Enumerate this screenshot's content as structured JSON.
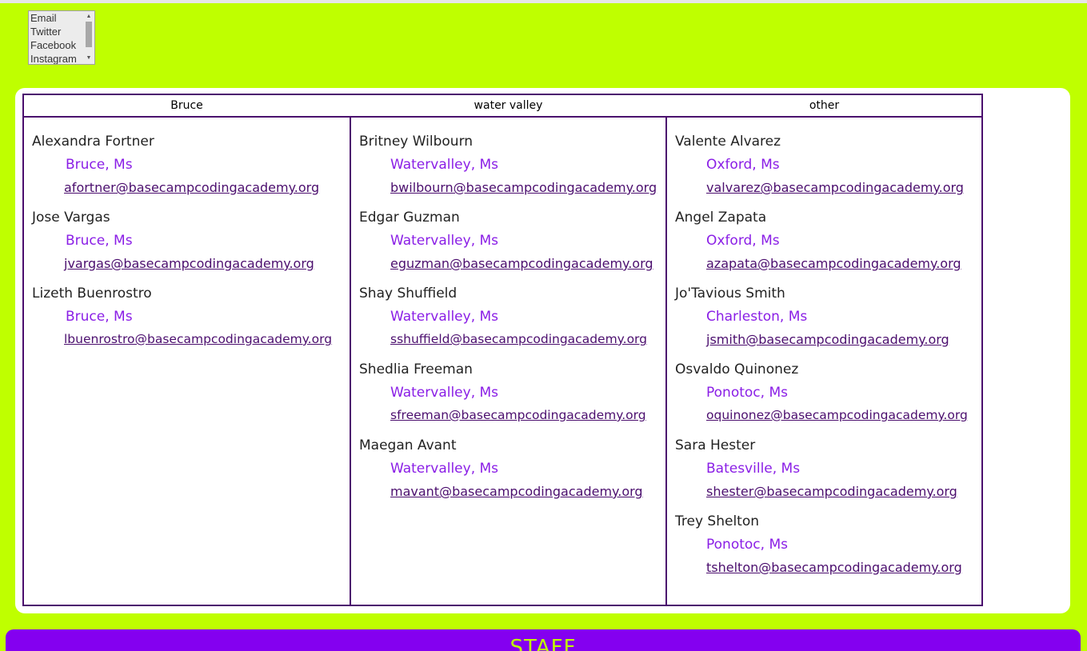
{
  "social_select": {
    "options": [
      "Email",
      "Twitter",
      "Facebook",
      "Instagram"
    ]
  },
  "table": {
    "headers": [
      "Bruce",
      "water valley",
      "other"
    ],
    "columns": [
      [
        {
          "name": "Alexandra Fortner",
          "location": "Bruce, Ms",
          "email": "afortner@basecampcodingacademy.org"
        },
        {
          "name": "Jose Vargas",
          "location": "Bruce, Ms",
          "email": "jvargas@basecampcodingacademy.org"
        },
        {
          "name": "Lizeth Buenrostro",
          "location": "Bruce, Ms",
          "email": "lbuenrostro@basecampcodingacademy.org"
        }
      ],
      [
        {
          "name": "Britney Wilbourn",
          "location": "Watervalley, Ms",
          "email": "bwilbourn@basecampcodingacademy.org"
        },
        {
          "name": "Edgar Guzman",
          "location": "Watervalley, Ms",
          "email": "eguzman@basecampcodingacademy.org"
        },
        {
          "name": "Shay Shuffield",
          "location": "Watervalley, Ms",
          "email": "sshuffield@basecampcodingacademy.org"
        },
        {
          "name": "Shedlia Freeman",
          "location": "Watervalley, Ms",
          "email": "sfreeman@basecampcodingacademy.org"
        },
        {
          "name": "Maegan Avant",
          "location": "Watervalley, Ms",
          "email": "mavant@basecampcodingacademy.org"
        }
      ],
      [
        {
          "name": "Valente Alvarez",
          "location": "Oxford, Ms",
          "email": "valvarez@basecampcodingacademy.org"
        },
        {
          "name": "Angel Zapata",
          "location": "Oxford, Ms",
          "email": "azapata@basecampcodingacademy.org"
        },
        {
          "name": "Jo'Tavious Smith",
          "location": "Charleston, Ms",
          "email": "jsmith@basecampcodingacademy.org"
        },
        {
          "name": "Osvaldo Quinonez",
          "location": "Ponotoc, Ms",
          "email": "oquinonez@basecampcodingacademy.org"
        },
        {
          "name": "Sara Hester",
          "location": "Batesville, Ms",
          "email": "shester@basecampcodingacademy.org"
        },
        {
          "name": "Trey Shelton",
          "location": "Ponotoc, Ms",
          "email": "tshelton@basecampcodingacademy.org"
        }
      ]
    ]
  },
  "staff_section": {
    "title": "STAFF"
  },
  "colors": {
    "background": "#bfff00",
    "accent_purple": "#8400f0",
    "border_purple": "#4b0e6e",
    "location_purple": "#8a1ee6"
  }
}
